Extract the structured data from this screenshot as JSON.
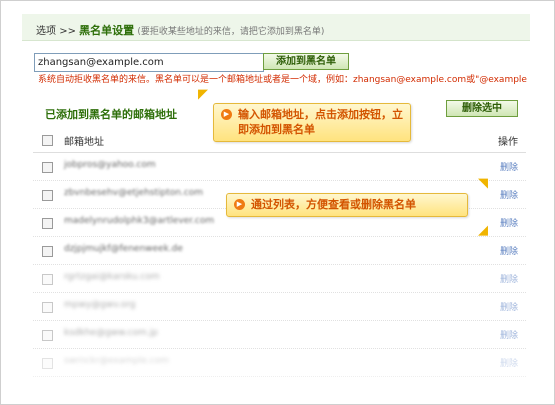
{
  "breadcrumb": {
    "home": "选项",
    "sep": ">>",
    "title": "黑名单设置",
    "hint": "(要拒收某些地址的来信，请把它添加到黑名单)"
  },
  "form": {
    "email_value": "zhangsan@example.com",
    "add_button": "添加到黑名单"
  },
  "notice": "系统自动拒收黑名单的来信。黑名单可以是一个邮箱地址或者是一个域，例如：zhangsan@example.com或\"@example",
  "list": {
    "title": "已添加到黑名单的邮箱地址",
    "delete_selected": "删除选中",
    "col_email": "邮箱地址",
    "col_action": "操作",
    "delete_label": "删除",
    "rows": [
      "jobpros@yahoo.com",
      "zbvnbesehv@etjehstipton.com",
      "madelynrudolphk3@artlever.com",
      "dzjpjmujkf@fenenweek.de",
      "rgrtzgai@karsku.com",
      "mpwy@gwv.org",
      "ksdkhe@gww.com.jp",
      "swrnckr@example.com"
    ]
  },
  "callouts": {
    "input_tip": "输入邮箱地址，点击添加按钮，立即添加到黑名单",
    "list_tip": "通过列表，方便查看或删除黑名单"
  },
  "colors": {
    "title_green": "#2e6f0a",
    "notice_red": "#d22b00",
    "link_blue": "#5a7fc0",
    "callout_orange": "#d35400"
  }
}
